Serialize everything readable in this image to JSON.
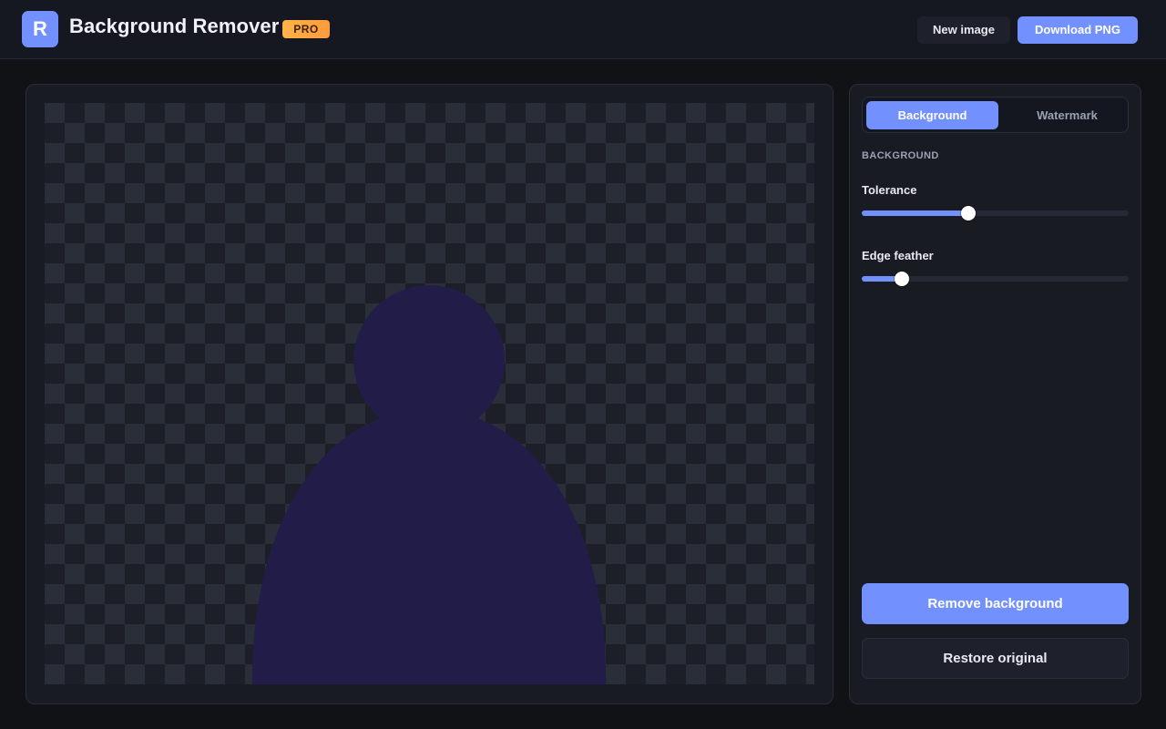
{
  "header": {
    "logo_letter": "R",
    "title": "Background Remover",
    "badge": "PRO",
    "new_image_label": "New image",
    "download_label": "Download PNG"
  },
  "tabs": [
    {
      "label": "Background",
      "active": true
    },
    {
      "label": "Watermark",
      "active": false
    }
  ],
  "panel": {
    "section_title": "BACKGROUND",
    "sliders": [
      {
        "label": "Tolerance",
        "value_fraction": 0.4
      },
      {
        "label": "Edge feather",
        "value_fraction": 0.15
      }
    ],
    "remove_label": "Remove background",
    "restore_label": "Restore original"
  },
  "colors": {
    "accent": "#7390ff",
    "subject": "#221d48",
    "badge": "#ff9a3c"
  }
}
